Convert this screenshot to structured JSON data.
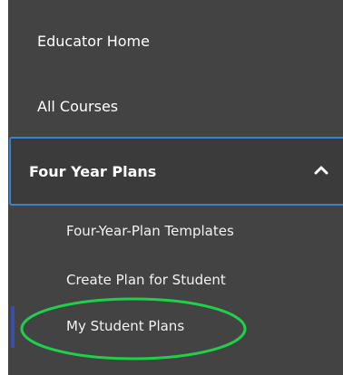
{
  "nav": {
    "educator_home": "Educator Home",
    "all_courses": "All Courses",
    "four_year_plans": {
      "label": "Four Year Plans",
      "expanded": true,
      "chevron_icon": "chevron-up-icon",
      "border_color": "#3b82cc",
      "items": [
        {
          "label": "Four-Year-Plan Templates"
        },
        {
          "label": "Create Plan for Student"
        },
        {
          "label": "My Student Plans",
          "active": true
        }
      ]
    }
  },
  "colors": {
    "sidebar_bg": "#434343",
    "active_indicator": "#3a4ea6",
    "highlight_annotation": "#1fd14a"
  }
}
